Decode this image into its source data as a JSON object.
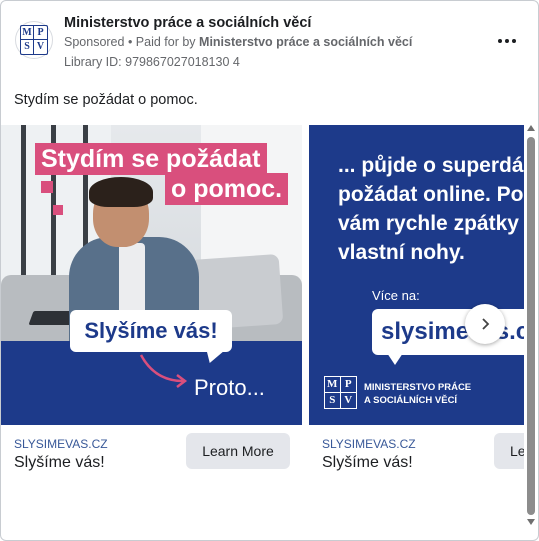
{
  "header": {
    "page_name": "Ministerstvo práce a sociálních věcí",
    "sponsored": "Sponsored",
    "paid_for_prefix": " • Paid for by ",
    "paid_for_name": "Ministerstvo práce a sociálních věcí",
    "library_id": "Library ID: 979867027018130 4",
    "logo_letters": [
      "M",
      "P",
      "S",
      "V"
    ]
  },
  "ad_text": "Stydím se požádat o pomoc.",
  "cards": [
    {
      "image": {
        "headline_line1": "Stydím se požádat",
        "headline_line2": "o pomoc.",
        "bubble": "Slyšíme vás!",
        "proto": "Proto..."
      },
      "domain": "SLYSIMEVAS.CZ",
      "title": "Slyšíme vás!",
      "cta": "Learn More"
    },
    {
      "image": {
        "text_lines": [
          "... půjde o superdá",
          "požádat online. Po",
          "vám rychle zpátky n",
          "vlastní nohy."
        ],
        "vice_label": "Více na:",
        "url": "slysimevas.cz",
        "ministry_line1": "MINISTERSTVO PRÁCE",
        "ministry_line2": "A SOCIÁLNÍCH VĚCÍ",
        "logo_letters": [
          "M",
          "P",
          "S",
          "V"
        ]
      },
      "domain": "SLYSIMEVAS.CZ",
      "title": "Slyšíme vás!",
      "cta": "Le"
    }
  ],
  "colors": {
    "brand_blue": "#1d3a8a",
    "accent_pink": "#d94f7d",
    "link_blue": "#385898",
    "cta_gray": "#e4e6eb"
  }
}
